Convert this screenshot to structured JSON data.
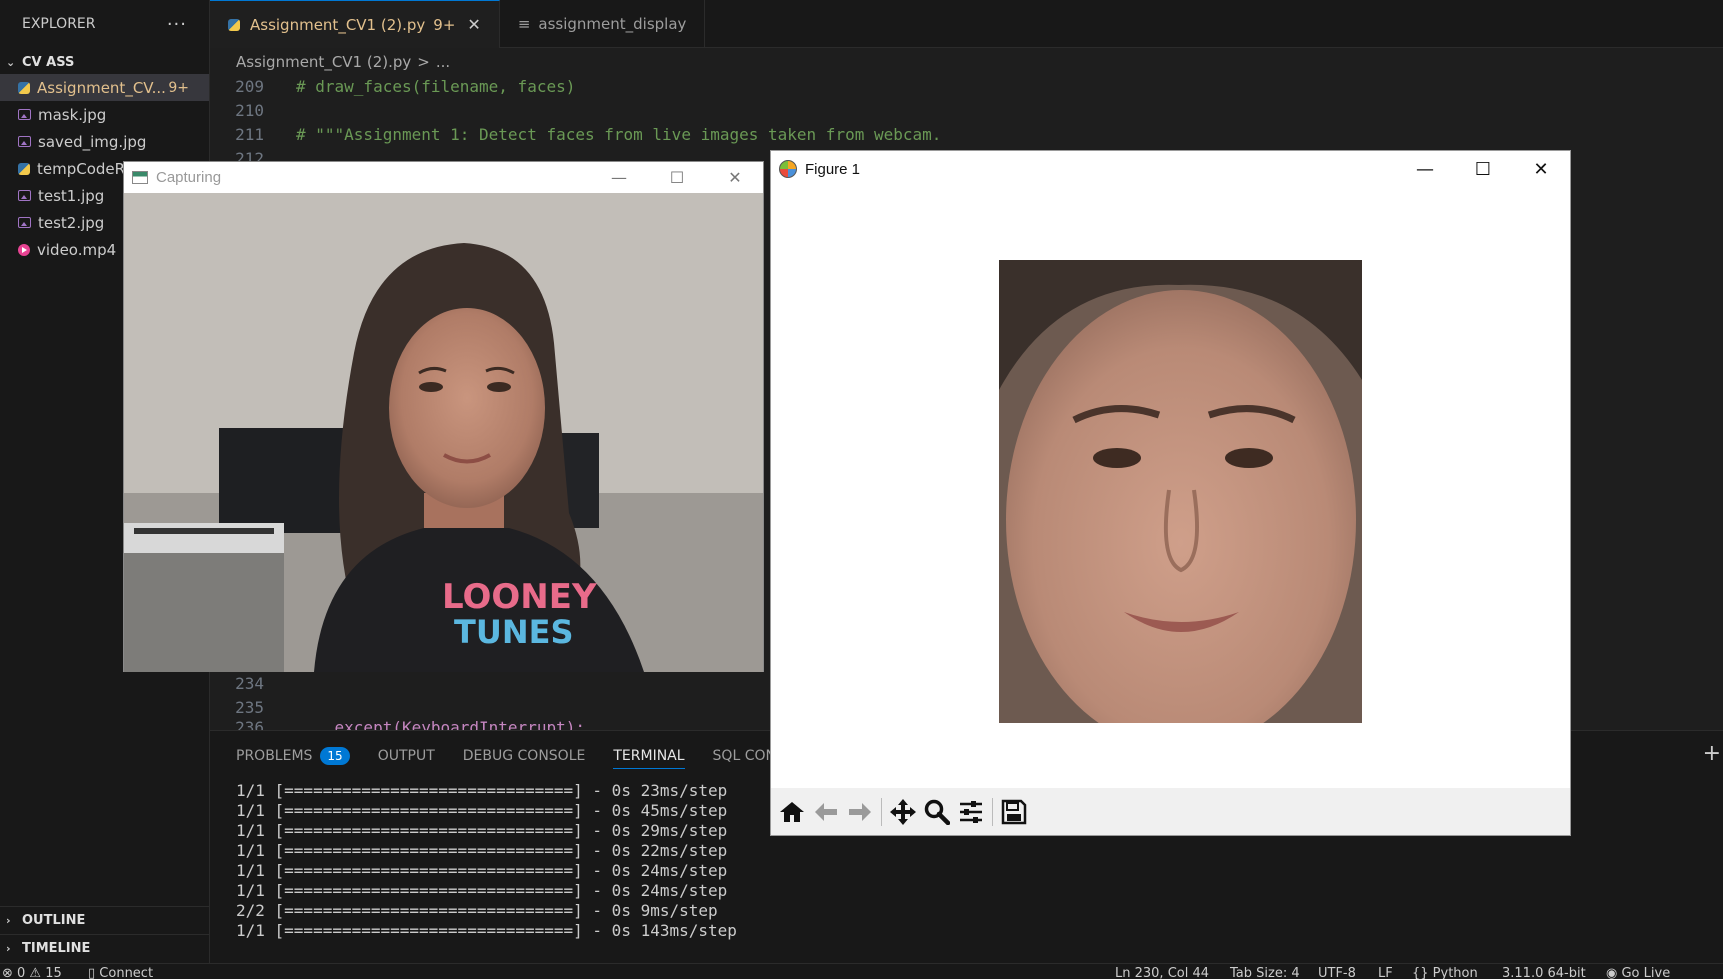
{
  "explorer": {
    "title": "EXPLORER",
    "more": "···",
    "folder": "CV ASS",
    "files": [
      {
        "name": "Assignment_CV...",
        "badge": "9+",
        "type": "py"
      },
      {
        "name": "mask.jpg",
        "type": "img"
      },
      {
        "name": "saved_img.jpg",
        "type": "img"
      },
      {
        "name": "tempCodeR",
        "type": "py"
      },
      {
        "name": "test1.jpg",
        "type": "img"
      },
      {
        "name": "test2.jpg",
        "type": "img"
      },
      {
        "name": "video.mp4",
        "type": "vid"
      }
    ],
    "outline": "OUTLINE",
    "timeline": "TIMELINE"
  },
  "tabs": [
    {
      "label": "Assignment_CV1 (2).py",
      "badge": "9+",
      "close": "✕"
    },
    {
      "label": "assignment_display"
    }
  ],
  "breadcrumb": {
    "file": "Assignment_CV1 (2).py",
    "sep": ">",
    "rest": "..."
  },
  "editor": {
    "lines": [
      {
        "n": "209",
        "text": "# draw_faces(filename, faces)"
      },
      {
        "n": "210",
        "text": ""
      },
      {
        "n": "211",
        "text": "# \"\"\"Assignment 1: Detect faces from live images taken from webcam."
      },
      {
        "n": "212",
        "text": ""
      },
      {
        "n": "234",
        "text": ""
      },
      {
        "n": "235",
        "text": ""
      },
      {
        "n": "236",
        "text": "    except(KeyboardInterrupt):"
      }
    ]
  },
  "panel": {
    "tabs": [
      {
        "label": "PROBLEMS",
        "count": "15"
      },
      {
        "label": "OUTPUT"
      },
      {
        "label": "DEBUG CONSOLE"
      },
      {
        "label": "TERMINAL"
      },
      {
        "label": "SQL CONSOLE"
      }
    ],
    "active_tab": "TERMINAL",
    "terminal": [
      "1/1 [==============================] - 0s 23ms/step",
      "1/1 [==============================] - 0s 45ms/step",
      "1/1 [==============================] - 0s 29ms/step",
      "1/1 [==============================] - 0s 22ms/step",
      "1/1 [==============================] - 0s 24ms/step",
      "1/1 [==============================] - 0s 24ms/step",
      "2/2 [==============================] - 0s 9ms/step",
      "1/1 [==============================] - 0s 143ms/step"
    ],
    "plus": "+"
  },
  "statusbar": {
    "problems": "⊗ 0 ⚠ 15",
    "connect": "Connect",
    "position": "Ln 230, Col 44",
    "tabsize": "Tab Size: 4",
    "encoding": "UTF-8",
    "eol": "LF",
    "language": "{} Python",
    "interpreter": "3.11.0 64-bit",
    "golive": "Go Live"
  },
  "capture_window": {
    "title": "Capturing",
    "minimize": "—",
    "maximize": "☐",
    "close": "✕",
    "shirt_text_1": "LOONEY",
    "shirt_text_2": "TUNES"
  },
  "figure_window": {
    "title": "Figure 1",
    "minimize": "—",
    "maximize": "☐",
    "close": "✕"
  },
  "toolbar_icons": [
    "home-icon",
    "back-arrow-icon",
    "forward-arrow-icon",
    "pan-icon",
    "zoom-icon",
    "configure-subplots-icon",
    "save-icon"
  ],
  "colors": {
    "accent": "#0078d4",
    "modified": "#e2c08d",
    "comment": "#6a9955"
  }
}
